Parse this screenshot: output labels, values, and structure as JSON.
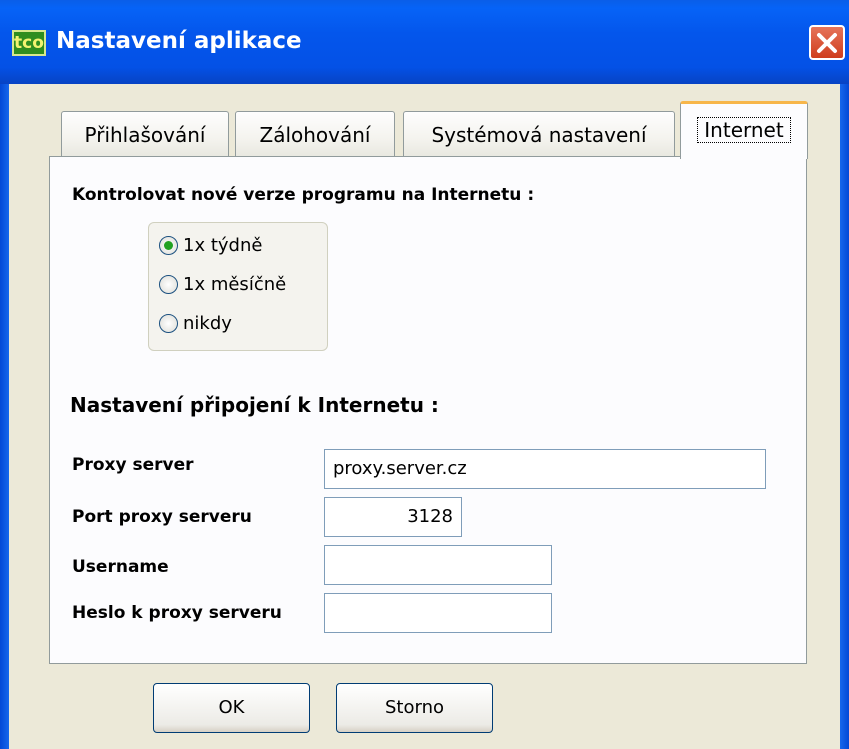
{
  "window": {
    "icon_text": "tco",
    "title": "Nastavení aplikace"
  },
  "tabs": [
    {
      "label": "Přihlašování",
      "active": false
    },
    {
      "label": "Zálohování",
      "active": false
    },
    {
      "label": "Systémová nastavení",
      "active": false
    },
    {
      "label": "Internet",
      "active": true
    }
  ],
  "internet": {
    "check_updates_label": "Kontrolovat nové verze programu na Internetu :",
    "update_options": [
      {
        "label": "1x týdně",
        "selected": true
      },
      {
        "label": "1x měsíčně",
        "selected": false
      },
      {
        "label": "nikdy",
        "selected": false
      }
    ],
    "connection_label": "Nastavení připojení k Internetu :",
    "proxy_server_label": "Proxy server",
    "proxy_server_value": "proxy.server.cz",
    "proxy_port_label": "Port proxy serveru",
    "proxy_port_value": "3128",
    "username_label": "Username",
    "username_value": "",
    "password_label": "Heslo k proxy serveru",
    "password_value": ""
  },
  "buttons": {
    "ok": "OK",
    "cancel": "Storno"
  },
  "colors": {
    "titlebar": "#0451e6",
    "dialog_bg": "#ece9d8",
    "active_tab_accent": "#f7b64a",
    "radio_selected": "#21a121"
  }
}
